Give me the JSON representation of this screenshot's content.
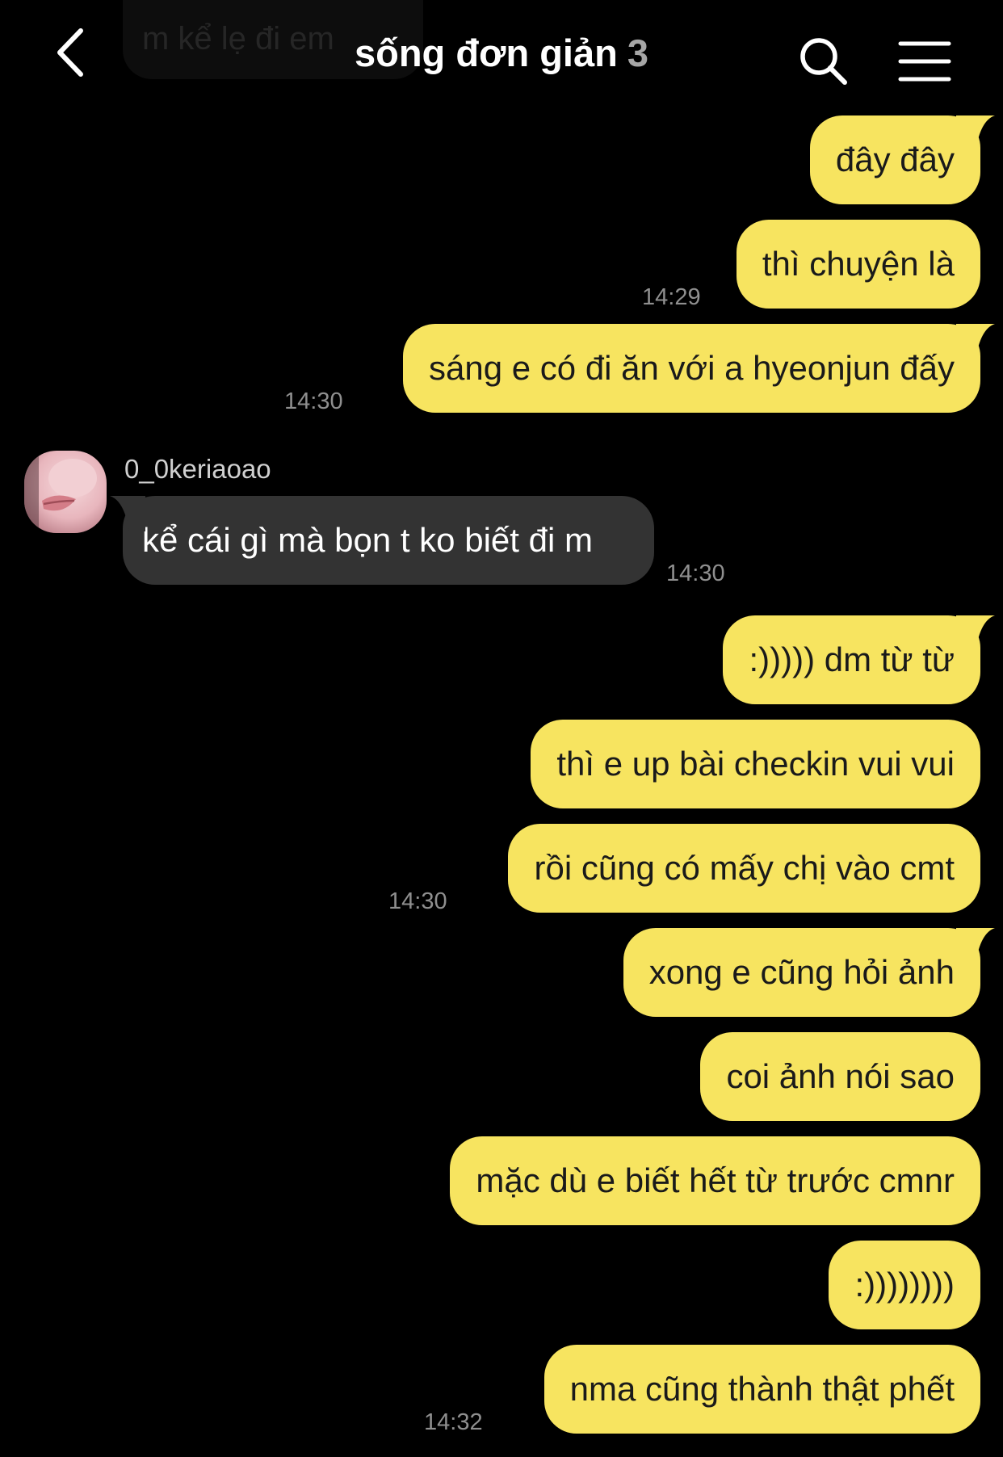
{
  "header": {
    "title": "sống đơn giản",
    "member_count": "3",
    "ghost_message": "m kể lẹ đi em"
  },
  "colors": {
    "background": "#000000",
    "outgoing_bubble": "#f7e460",
    "incoming_bubble": "#333333",
    "timestamp": "#8f8f8f"
  },
  "messages": {
    "m1": {
      "text": "đây đây"
    },
    "m2": {
      "text": "thì chuyện là",
      "time": "14:29"
    },
    "m3": {
      "text": "sáng e có đi ăn với a hyeonjun đấy",
      "time": "14:30"
    },
    "m4": {
      "sender": "0_0keriaoao",
      "text": "kể cái gì mà bọn t ko biết đi m",
      "time": "14:30"
    },
    "m5": {
      "text": ":))))) dm từ từ"
    },
    "m6": {
      "text": "thì e up bài checkin vui vui"
    },
    "m7": {
      "text": "rồi cũng có mấy chị vào cmt",
      "time": "14:30"
    },
    "m8": {
      "text": "xong e cũng hỏi ảnh"
    },
    "m9": {
      "text": "coi ảnh nói sao"
    },
    "m10": {
      "text": "mặc dù e biết hết từ trước cmnr"
    },
    "m11": {
      "text": ":))))))))"
    },
    "m12": {
      "text": "nma cũng thành thật phết",
      "time": "14:32"
    }
  },
  "icons": {
    "back": "chevron-left-icon",
    "search": "search-icon",
    "menu": "hamburger-menu-icon"
  }
}
